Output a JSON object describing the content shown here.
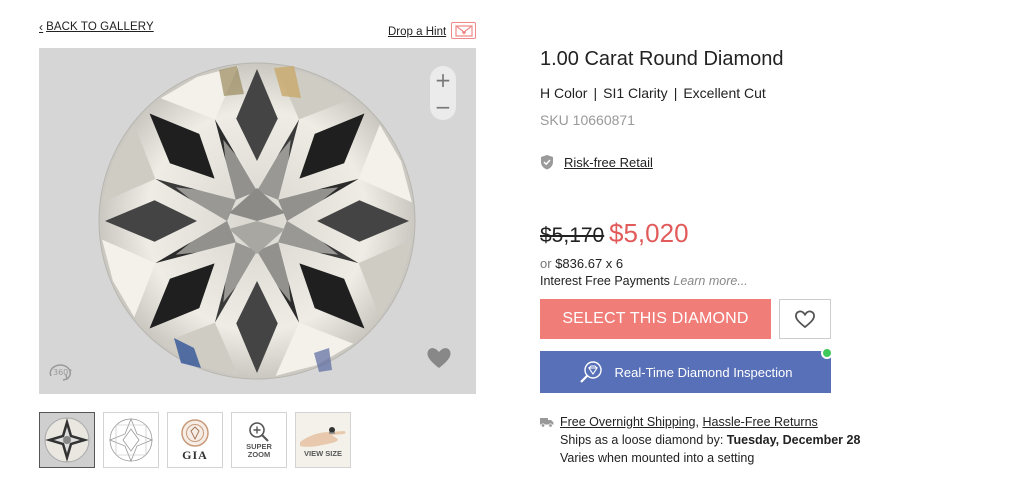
{
  "nav": {
    "back_label": "BACK TO GALLERY",
    "hint_label": "Drop a Hint"
  },
  "viewer": {
    "zoom_in": "+",
    "zoom_out": "−",
    "rotate_label": "360°"
  },
  "thumbnails": [
    {
      "name": "photo",
      "label": ""
    },
    {
      "name": "diagram",
      "label": ""
    },
    {
      "name": "gia-certificate",
      "label": "GIA"
    },
    {
      "name": "super-zoom",
      "label": "SUPER ZOOM"
    },
    {
      "name": "view-size",
      "label": "VIEW SIZE"
    }
  ],
  "product": {
    "title": "1.00 Carat Round Diamond",
    "color": "H Color",
    "clarity": "SI1 Clarity",
    "cut": "Excellent Cut",
    "separator": "|",
    "sku": "SKU 10660871",
    "riskfree_label": "Risk-free Retail"
  },
  "pricing": {
    "original": "$5,170",
    "sale": "$5,020",
    "installment_or": "or",
    "installment_amount": "$836.67 x 6",
    "interest_text": "Interest Free Payments",
    "learn_more": "Learn more..."
  },
  "actions": {
    "select_label": "SELECT THIS DIAMOND",
    "inspection_label": "Real-Time Diamond Inspection"
  },
  "shipping": {
    "free_shipping": "Free Overnight Shipping",
    "comma": ",",
    "returns": "Hassle-Free Returns",
    "ships_prefix": "Ships as a loose diamond by:",
    "ships_date": "Tuesday, December 28",
    "mounted_note": "Varies when mounted into a setting"
  },
  "colors": {
    "accent_pink": "#f17d79",
    "sale_red": "#e15b5b",
    "inspection_blue": "#5870b8",
    "live_green": "#3ec95a"
  }
}
